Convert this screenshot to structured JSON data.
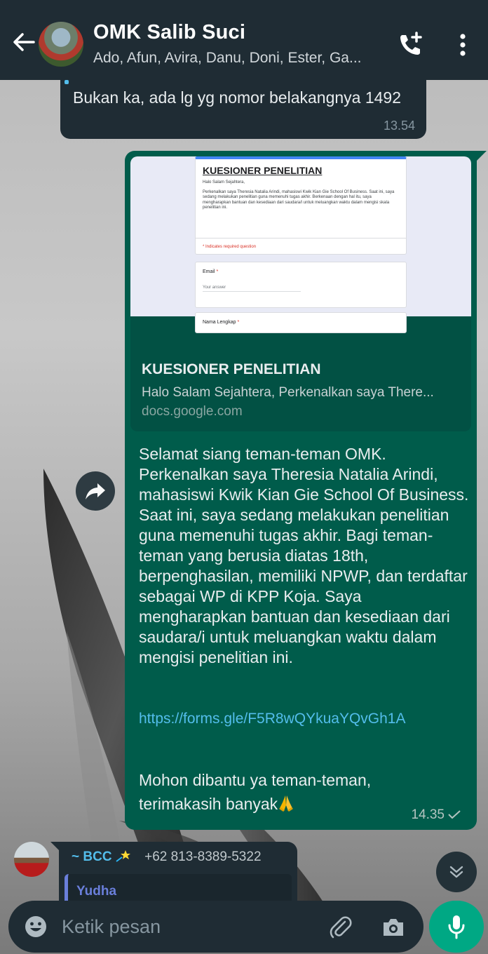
{
  "header": {
    "title": "OMK Salib Suci",
    "subtitle": "Ado, Afun, Avira, Danu, Doni, Ester, Ga..."
  },
  "messages": [
    {
      "direction": "incoming",
      "text": "Bukan ka, ada lg yg nomor belakangnya 1492",
      "time": "13.54"
    },
    {
      "direction": "outgoing",
      "link_preview": {
        "form_title": "KUESIONER PENELITIAN",
        "form_greeting": "Halo Salam Sejahtera,",
        "form_intro": "Perkenalkan saya Theresia Natalia Arindi, mahasiswi Kwik Kian Gie School Of Business. Saat ini, saya sedang melakukan penelitian guna memenuhi tugas akhir. Berkenaan dengan hal itu, saya mengharapkan bantuan dan kesediaan dari saudara/i untuk meluangkan waktu dalam mengisi skala penelitian ini.",
        "form_required_note": "* Indicates required question",
        "form_email_label": "Email",
        "form_required_star": "*",
        "form_answer_placeholder": "Your answer",
        "form_name_label": "Nama Lengkap",
        "title": "KUESIONER PENELITIAN",
        "description": "Halo Salam Sejahtera, Perkenalkan saya There...",
        "domain": "docs.google.com"
      },
      "body": "Selamat siang teman-teman OMK. Perkenalkan saya Theresia Natalia Arindi, mahasiswi Kwik Kian Gie School Of Business. Saat ini, saya sedang melakukan penelitian guna memenuhi tugas akhir. Bagi teman-teman yang berusia diatas 18th, berpenghasilan, memiliki NPWP, dan terdaftar sebagai WP di KPP Koja. Saya mengharapkan bantuan dan kesediaan dari saudara/i untuk meluangkan waktu dalam mengisi penelitian ini.",
      "link": "https://forms.gle/F5R8wQYkuaYQvGh1A",
      "closing": "Mohon dibantu ya teman-teman, terimakasih banyak",
      "time": "14.35",
      "status": "sent"
    },
    {
      "direction": "incoming",
      "sender_name": "~ BCC",
      "sender_phone": "+62 813-8389-5322",
      "quoted_name": "Yudha"
    }
  ],
  "composer": {
    "placeholder": "Ketik pesan"
  },
  "icons": {
    "back": "arrow-left-icon",
    "call": "add-call-icon",
    "menu": "more-vertical-icon",
    "forward": "forward-icon",
    "scroll_down": "chevron-double-down-icon",
    "emoji": "emoji-icon",
    "attach": "paperclip-icon",
    "camera": "camera-icon",
    "mic": "microphone-icon"
  },
  "colors": {
    "header_bg": "#1f2c34",
    "outgoing_bubble": "#005c4b",
    "incoming_bubble": "#1f2c34",
    "link": "#53bdeb",
    "mic_button": "#00a884"
  }
}
